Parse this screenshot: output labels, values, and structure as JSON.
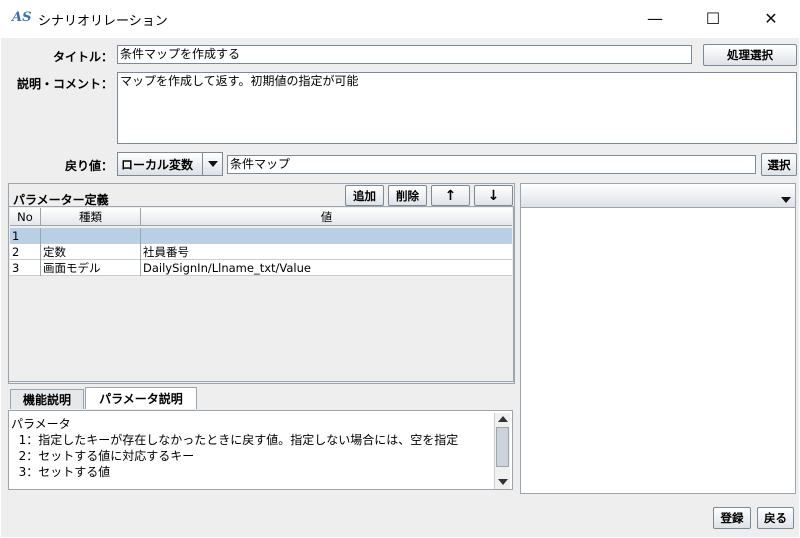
{
  "window": {
    "app_icon_text": "AS",
    "title": "シナリオリレーション",
    "minimize_glyph": "—",
    "maximize_glyph": "☐",
    "close_glyph": "✕"
  },
  "form": {
    "title_label": "タイトル：",
    "title_value": "条件マップを作成する",
    "process_select_label": "処理選択",
    "comment_label": "説明・コメント：",
    "comment_value": "マップを作成して返す。初期値の指定が可能",
    "return_label": "戻り値：",
    "return_type": "ローカル変数",
    "return_value": "条件マップ",
    "select_label": "選択"
  },
  "params": {
    "section_title": "パラメーター定義",
    "add_label": "追加",
    "delete_label": "削除",
    "up_label": "↑",
    "down_label": "↓",
    "columns": [
      "No",
      "種類",
      "値"
    ],
    "rows": [
      {
        "no": "1",
        "type": "",
        "value": ""
      },
      {
        "no": "2",
        "type": "定数",
        "value": "社員番号"
      },
      {
        "no": "3",
        "type": "画面モデル",
        "value": "DailySignIn/Llname_txt/Value"
      }
    ]
  },
  "tabs": [
    {
      "label": "機能説明",
      "active": false
    },
    {
      "label": "パラメータ説明",
      "active": true
    }
  ],
  "description": {
    "lines": [
      "パラメータ",
      "  1：指定したキーが存在しなかったときに戻す値。指定しない場合には、空を指定",
      "  2：セットする値に対応するキー",
      "  3：セットする値"
    ]
  },
  "right_panel": {
    "dropdown_value": ""
  },
  "footer": {
    "register_label": "登録",
    "back_label": "戻る"
  },
  "icons": {
    "dropdown": "chevron-down-icon",
    "scroll_up": "triangle-up-icon",
    "scroll_down": "triangle-down-icon"
  }
}
